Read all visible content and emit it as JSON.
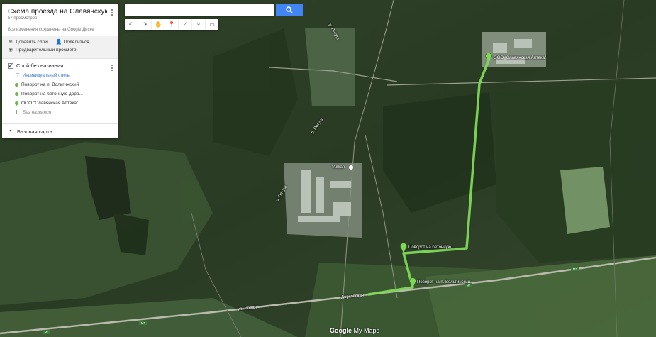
{
  "panel": {
    "title": "Схема проезда на Славянскую ...",
    "views": "57 просмотров",
    "saved_status": "Все изменения сохранены на Google Диске",
    "actions": {
      "add_layer": "Добавить слой",
      "share": "Поделиться",
      "preview": "Предварительный просмотр"
    },
    "layer": {
      "name": "Слой без названия",
      "style_link": "Индивидуальный стиль",
      "items": [
        {
          "label": "Поворот на п. Вольгинский",
          "icon": "pin-icon"
        },
        {
          "label": "Поворот на бетонную доро...",
          "icon": "pin-icon"
        },
        {
          "label": "ООО \"Славянская Аптека\"",
          "icon": "pin-icon"
        },
        {
          "label": "Без названия",
          "icon": "line-icon"
        }
      ]
    },
    "basemap_label": "Базовая карта"
  },
  "search": {
    "value": "",
    "placeholder": ""
  },
  "toolbar": {
    "tools": [
      "undo-icon",
      "redo-icon",
      "hand-icon",
      "marker-icon",
      "line-icon",
      "directions-icon",
      "ruler-icon"
    ]
  },
  "map": {
    "labels": {
      "pharmacy": "ООО \"Славянская Аптека\"",
      "turn_concrete": "Поворот на бетонную...",
      "turn_volginsky": "Поворот на п. Вольгинский",
      "vulkan": "Vulkan",
      "road_1": "Дорковская",
      "road_2": "ул. Новая",
      "river_1": "р. Петуш",
      "river_2": "р. Петуш",
      "river_3": "р. Петуш",
      "shield_1": "M7",
      "shield_2": "M7",
      "shield_3": "M7",
      "shield_4": "M7"
    },
    "route_color": "#7ed957",
    "logo_google": "Google",
    "logo_mymaps": "My Maps"
  }
}
